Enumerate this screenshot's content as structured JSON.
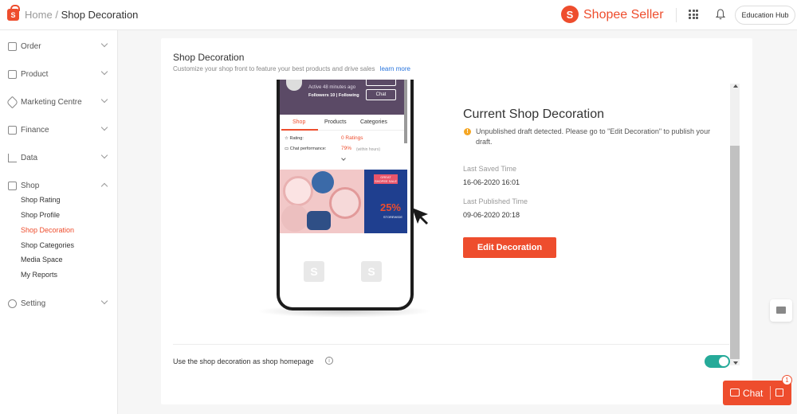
{
  "header": {
    "home": "Home",
    "separator": "/",
    "current": "Shop Decoration",
    "brand": "Shopee Seller",
    "education_hub": "Education Hub"
  },
  "sidebar": {
    "items": [
      {
        "label": "Order"
      },
      {
        "label": "Product"
      },
      {
        "label": "Marketing Centre"
      },
      {
        "label": "Finance"
      },
      {
        "label": "Data"
      },
      {
        "label": "Shop"
      },
      {
        "label": "Setting"
      }
    ],
    "shop_sub": [
      {
        "label": "Shop Rating"
      },
      {
        "label": "Shop Profile"
      },
      {
        "label": "Shop Decoration",
        "active": true
      },
      {
        "label": "Shop Categories"
      },
      {
        "label": "Media Space"
      },
      {
        "label": "My Reports"
      }
    ]
  },
  "main": {
    "title": "Shop Decoration",
    "description": "Customize your shop front to feature your best products and drive sales",
    "learn_more": "learn more",
    "current_title": "Current Shop Decoration",
    "warning": "Unpublished draft detected. Please go to \"Edit Decoration\" to publish your draft.",
    "last_saved_label": "Last Saved Time",
    "last_saved_value": "16-06-2020 16:01",
    "last_published_label": "Last Published Time",
    "last_published_value": "09-06-2020 20:18",
    "edit_button": "Edit Decoration",
    "homepage_label": "Use the shop decoration as shop homepage",
    "homepage_toggle_on": true
  },
  "phone": {
    "active": "Active 48 minutes ago",
    "followers": "Followers 10  |  Following",
    "chat": "Chat",
    "tabs": [
      "Shop",
      "Products",
      "Categories"
    ],
    "rating_label": "Rating:",
    "rating_value": "0 Ratings",
    "chat_perf_label": "Chat performance:",
    "chat_perf_value": "79%",
    "chat_perf_note": "(within hours)",
    "banner_tag": "GREAT SHOPEE SALE",
    "banner_pct": "25%",
    "banner_sub": "STOREWIDE"
  },
  "chat_widget": {
    "label": "Chat",
    "badge": "1"
  }
}
